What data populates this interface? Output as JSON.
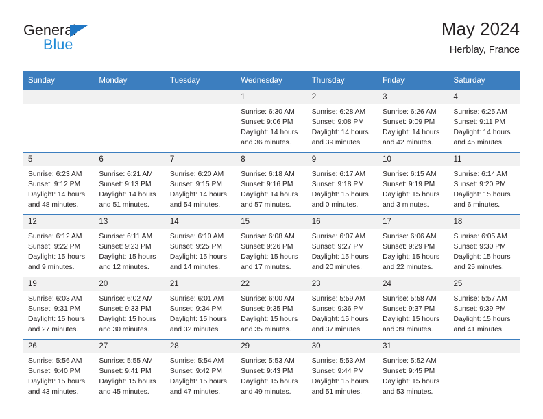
{
  "brand": {
    "name_part1": "General",
    "name_part2": "Blue",
    "accent_color": "#1f8ad6",
    "triangle_color": "#1f76c4"
  },
  "header": {
    "title": "May 2024",
    "subtitle": "Herblay, France"
  },
  "theme": {
    "header_blue": "#3c7ebf",
    "daynum_band": "#f1f1f1",
    "text": "#231f20"
  },
  "weekday_headers": [
    "Sunday",
    "Monday",
    "Tuesday",
    "Wednesday",
    "Thursday",
    "Friday",
    "Saturday"
  ],
  "weeks": [
    [
      {
        "day": "",
        "sunrise": "",
        "sunset": "",
        "daylight_line1": "",
        "daylight_line2": ""
      },
      {
        "day": "",
        "sunrise": "",
        "sunset": "",
        "daylight_line1": "",
        "daylight_line2": ""
      },
      {
        "day": "",
        "sunrise": "",
        "sunset": "",
        "daylight_line1": "",
        "daylight_line2": ""
      },
      {
        "day": "1",
        "sunrise": "Sunrise: 6:30 AM",
        "sunset": "Sunset: 9:06 PM",
        "daylight_line1": "Daylight: 14 hours",
        "daylight_line2": "and 36 minutes."
      },
      {
        "day": "2",
        "sunrise": "Sunrise: 6:28 AM",
        "sunset": "Sunset: 9:08 PM",
        "daylight_line1": "Daylight: 14 hours",
        "daylight_line2": "and 39 minutes."
      },
      {
        "day": "3",
        "sunrise": "Sunrise: 6:26 AM",
        "sunset": "Sunset: 9:09 PM",
        "daylight_line1": "Daylight: 14 hours",
        "daylight_line2": "and 42 minutes."
      },
      {
        "day": "4",
        "sunrise": "Sunrise: 6:25 AM",
        "sunset": "Sunset: 9:11 PM",
        "daylight_line1": "Daylight: 14 hours",
        "daylight_line2": "and 45 minutes."
      }
    ],
    [
      {
        "day": "5",
        "sunrise": "Sunrise: 6:23 AM",
        "sunset": "Sunset: 9:12 PM",
        "daylight_line1": "Daylight: 14 hours",
        "daylight_line2": "and 48 minutes."
      },
      {
        "day": "6",
        "sunrise": "Sunrise: 6:21 AM",
        "sunset": "Sunset: 9:13 PM",
        "daylight_line1": "Daylight: 14 hours",
        "daylight_line2": "and 51 minutes."
      },
      {
        "day": "7",
        "sunrise": "Sunrise: 6:20 AM",
        "sunset": "Sunset: 9:15 PM",
        "daylight_line1": "Daylight: 14 hours",
        "daylight_line2": "and 54 minutes."
      },
      {
        "day": "8",
        "sunrise": "Sunrise: 6:18 AM",
        "sunset": "Sunset: 9:16 PM",
        "daylight_line1": "Daylight: 14 hours",
        "daylight_line2": "and 57 minutes."
      },
      {
        "day": "9",
        "sunrise": "Sunrise: 6:17 AM",
        "sunset": "Sunset: 9:18 PM",
        "daylight_line1": "Daylight: 15 hours",
        "daylight_line2": "and 0 minutes."
      },
      {
        "day": "10",
        "sunrise": "Sunrise: 6:15 AM",
        "sunset": "Sunset: 9:19 PM",
        "daylight_line1": "Daylight: 15 hours",
        "daylight_line2": "and 3 minutes."
      },
      {
        "day": "11",
        "sunrise": "Sunrise: 6:14 AM",
        "sunset": "Sunset: 9:20 PM",
        "daylight_line1": "Daylight: 15 hours",
        "daylight_line2": "and 6 minutes."
      }
    ],
    [
      {
        "day": "12",
        "sunrise": "Sunrise: 6:12 AM",
        "sunset": "Sunset: 9:22 PM",
        "daylight_line1": "Daylight: 15 hours",
        "daylight_line2": "and 9 minutes."
      },
      {
        "day": "13",
        "sunrise": "Sunrise: 6:11 AM",
        "sunset": "Sunset: 9:23 PM",
        "daylight_line1": "Daylight: 15 hours",
        "daylight_line2": "and 12 minutes."
      },
      {
        "day": "14",
        "sunrise": "Sunrise: 6:10 AM",
        "sunset": "Sunset: 9:25 PM",
        "daylight_line1": "Daylight: 15 hours",
        "daylight_line2": "and 14 minutes."
      },
      {
        "day": "15",
        "sunrise": "Sunrise: 6:08 AM",
        "sunset": "Sunset: 9:26 PM",
        "daylight_line1": "Daylight: 15 hours",
        "daylight_line2": "and 17 minutes."
      },
      {
        "day": "16",
        "sunrise": "Sunrise: 6:07 AM",
        "sunset": "Sunset: 9:27 PM",
        "daylight_line1": "Daylight: 15 hours",
        "daylight_line2": "and 20 minutes."
      },
      {
        "day": "17",
        "sunrise": "Sunrise: 6:06 AM",
        "sunset": "Sunset: 9:29 PM",
        "daylight_line1": "Daylight: 15 hours",
        "daylight_line2": "and 22 minutes."
      },
      {
        "day": "18",
        "sunrise": "Sunrise: 6:05 AM",
        "sunset": "Sunset: 9:30 PM",
        "daylight_line1": "Daylight: 15 hours",
        "daylight_line2": "and 25 minutes."
      }
    ],
    [
      {
        "day": "19",
        "sunrise": "Sunrise: 6:03 AM",
        "sunset": "Sunset: 9:31 PM",
        "daylight_line1": "Daylight: 15 hours",
        "daylight_line2": "and 27 minutes."
      },
      {
        "day": "20",
        "sunrise": "Sunrise: 6:02 AM",
        "sunset": "Sunset: 9:33 PM",
        "daylight_line1": "Daylight: 15 hours",
        "daylight_line2": "and 30 minutes."
      },
      {
        "day": "21",
        "sunrise": "Sunrise: 6:01 AM",
        "sunset": "Sunset: 9:34 PM",
        "daylight_line1": "Daylight: 15 hours",
        "daylight_line2": "and 32 minutes."
      },
      {
        "day": "22",
        "sunrise": "Sunrise: 6:00 AM",
        "sunset": "Sunset: 9:35 PM",
        "daylight_line1": "Daylight: 15 hours",
        "daylight_line2": "and 35 minutes."
      },
      {
        "day": "23",
        "sunrise": "Sunrise: 5:59 AM",
        "sunset": "Sunset: 9:36 PM",
        "daylight_line1": "Daylight: 15 hours",
        "daylight_line2": "and 37 minutes."
      },
      {
        "day": "24",
        "sunrise": "Sunrise: 5:58 AM",
        "sunset": "Sunset: 9:37 PM",
        "daylight_line1": "Daylight: 15 hours",
        "daylight_line2": "and 39 minutes."
      },
      {
        "day": "25",
        "sunrise": "Sunrise: 5:57 AM",
        "sunset": "Sunset: 9:39 PM",
        "daylight_line1": "Daylight: 15 hours",
        "daylight_line2": "and 41 minutes."
      }
    ],
    [
      {
        "day": "26",
        "sunrise": "Sunrise: 5:56 AM",
        "sunset": "Sunset: 9:40 PM",
        "daylight_line1": "Daylight: 15 hours",
        "daylight_line2": "and 43 minutes."
      },
      {
        "day": "27",
        "sunrise": "Sunrise: 5:55 AM",
        "sunset": "Sunset: 9:41 PM",
        "daylight_line1": "Daylight: 15 hours",
        "daylight_line2": "and 45 minutes."
      },
      {
        "day": "28",
        "sunrise": "Sunrise: 5:54 AM",
        "sunset": "Sunset: 9:42 PM",
        "daylight_line1": "Daylight: 15 hours",
        "daylight_line2": "and 47 minutes."
      },
      {
        "day": "29",
        "sunrise": "Sunrise: 5:53 AM",
        "sunset": "Sunset: 9:43 PM",
        "daylight_line1": "Daylight: 15 hours",
        "daylight_line2": "and 49 minutes."
      },
      {
        "day": "30",
        "sunrise": "Sunrise: 5:53 AM",
        "sunset": "Sunset: 9:44 PM",
        "daylight_line1": "Daylight: 15 hours",
        "daylight_line2": "and 51 minutes."
      },
      {
        "day": "31",
        "sunrise": "Sunrise: 5:52 AM",
        "sunset": "Sunset: 9:45 PM",
        "daylight_line1": "Daylight: 15 hours",
        "daylight_line2": "and 53 minutes."
      },
      {
        "day": "",
        "sunrise": "",
        "sunset": "",
        "daylight_line1": "",
        "daylight_line2": ""
      }
    ]
  ]
}
